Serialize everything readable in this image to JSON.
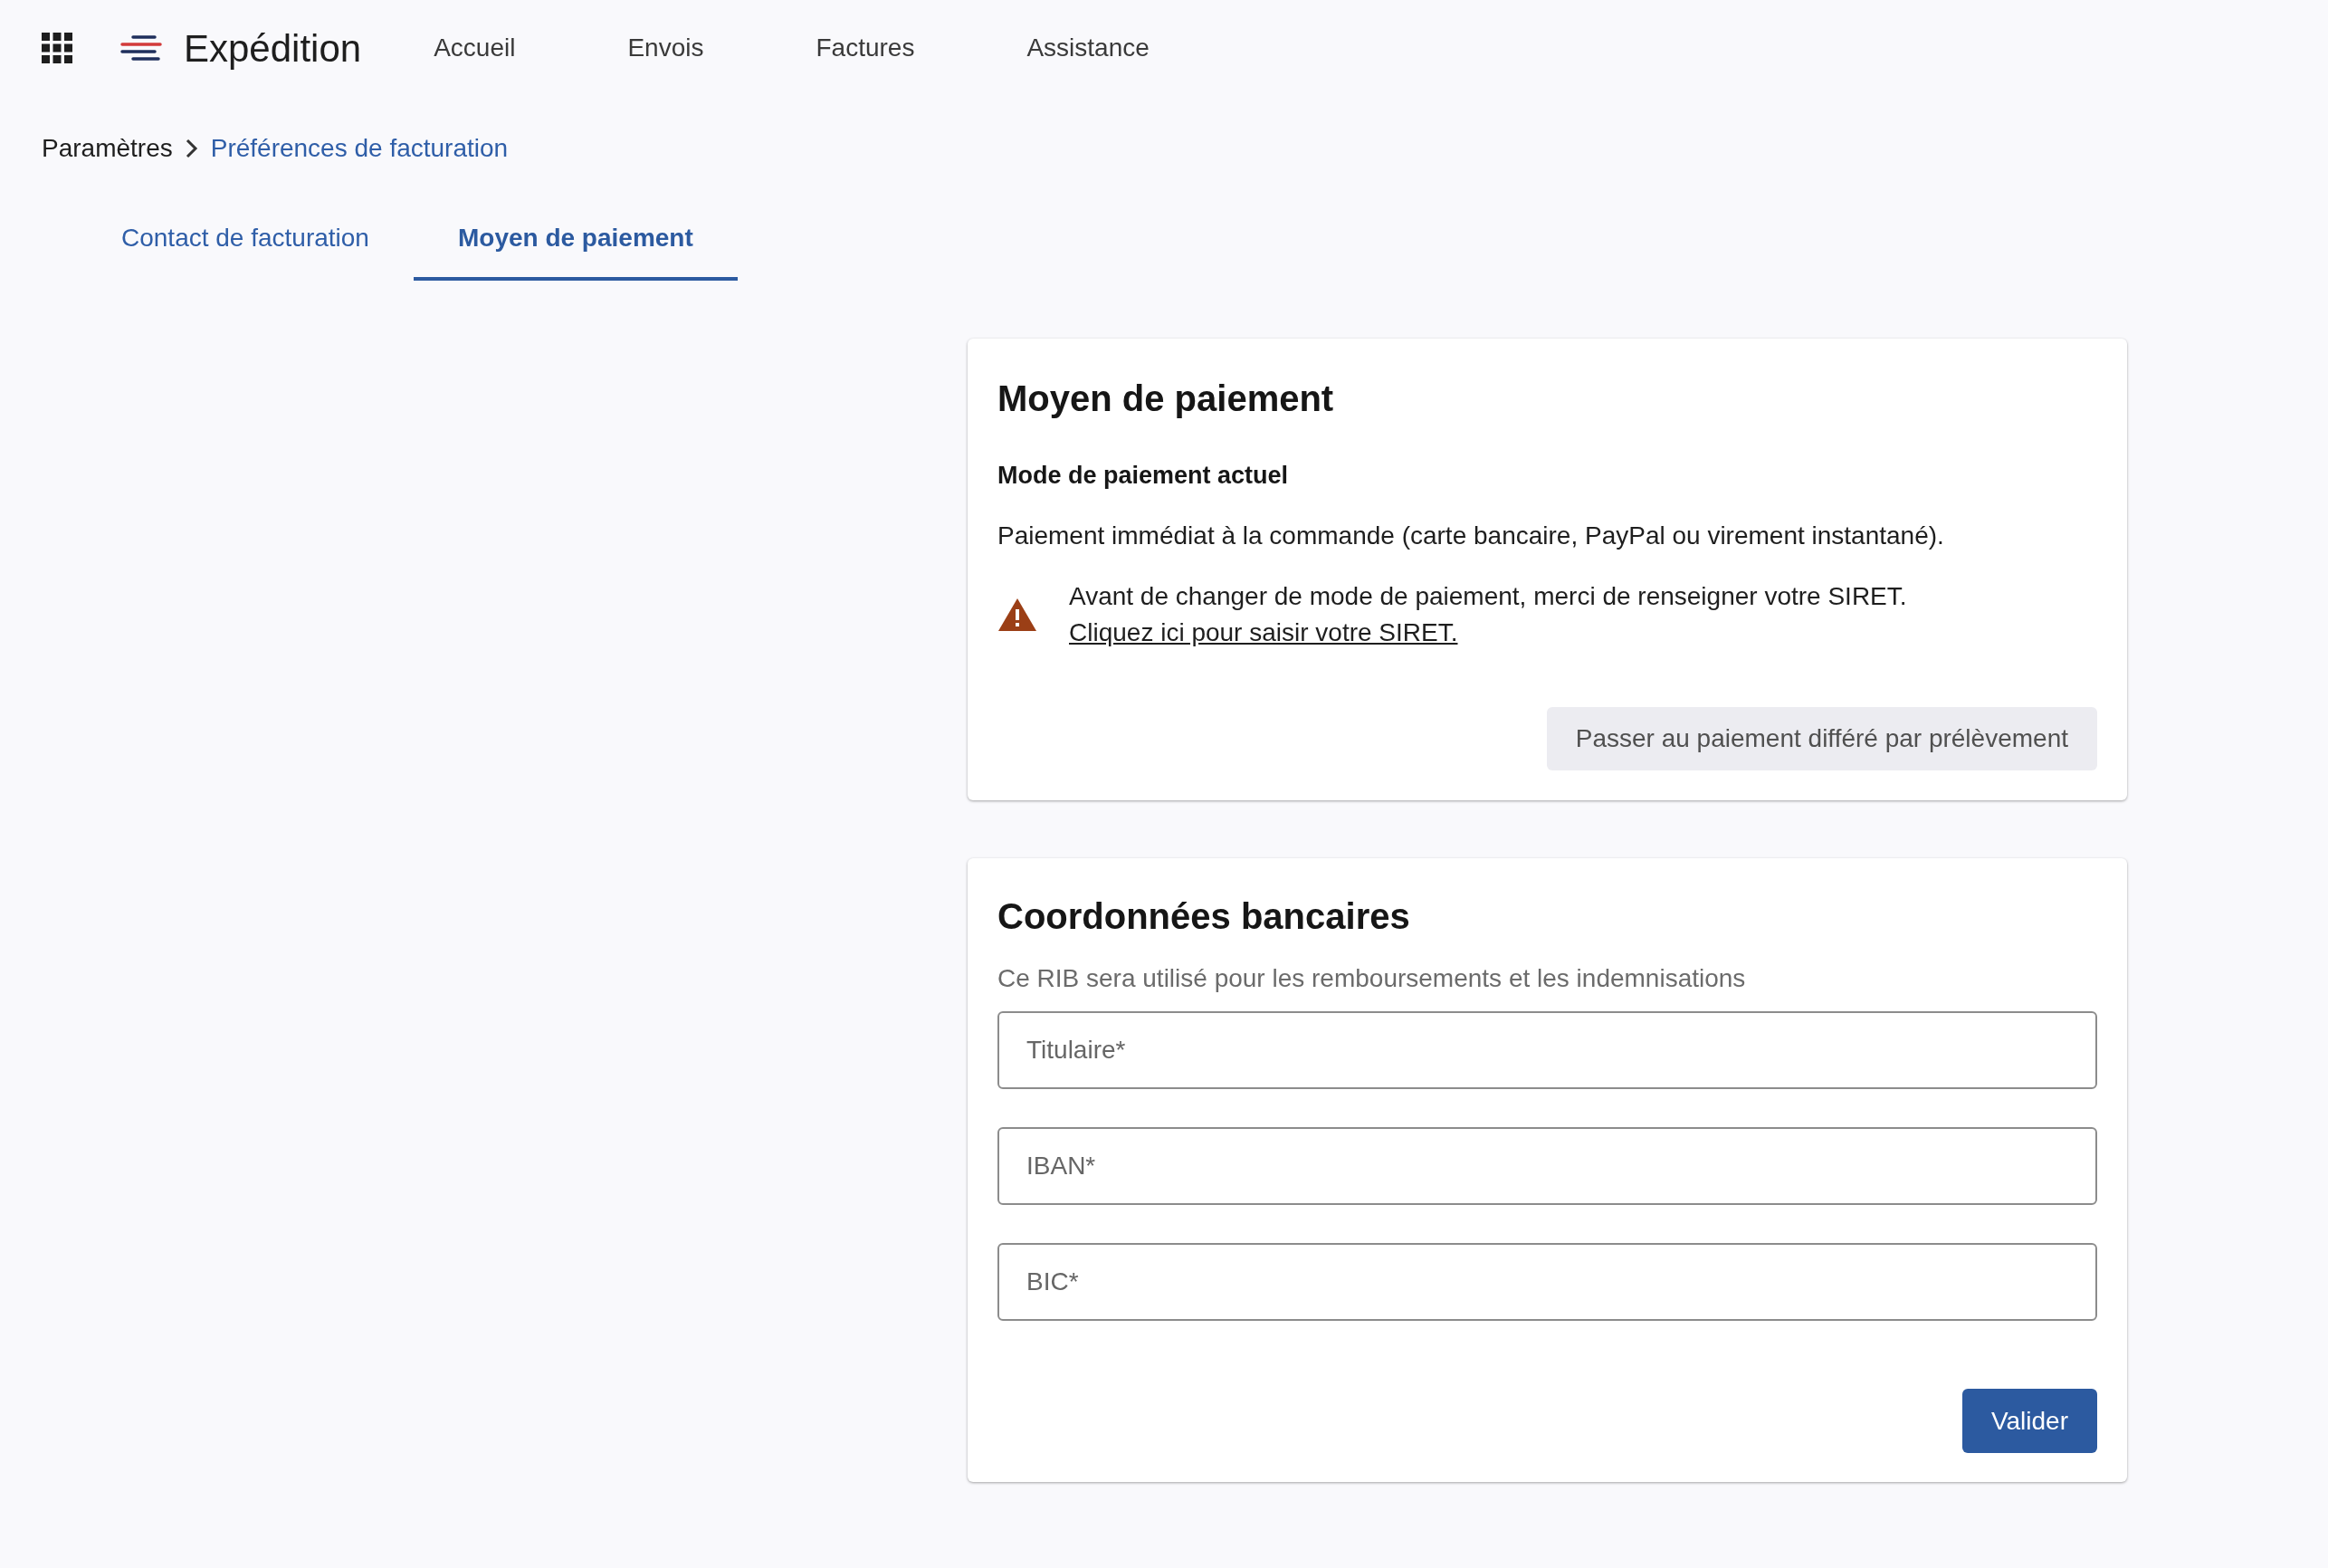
{
  "header": {
    "app_name": "Expédition",
    "nav": [
      {
        "label": "Accueil"
      },
      {
        "label": "Envois"
      },
      {
        "label": "Factures"
      },
      {
        "label": "Assistance"
      }
    ]
  },
  "breadcrumb": {
    "parent": "Paramètres",
    "current": "Préférences de facturation"
  },
  "tabs": [
    {
      "label": "Contact de facturation",
      "selected": false
    },
    {
      "label": "Moyen de paiement",
      "selected": true
    }
  ],
  "payment_card": {
    "title": "Moyen de paiement",
    "subtitle": "Mode de paiement actuel",
    "description": "Paiement immédiat à la commande (carte bancaire, PayPal ou virement instantané).",
    "warning": {
      "text": "Avant de changer de mode de paiement, merci de renseigner votre SIRET.",
      "link": "Cliquez ici pour saisir votre SIRET."
    },
    "button": "Passer au paiement différé par prélèvement"
  },
  "bank_card": {
    "title": "Coordonnées bancaires",
    "hint": "Ce RIB sera utilisé pour les remboursements et les indemnisations",
    "fields": [
      {
        "placeholder": "Titulaire*"
      },
      {
        "placeholder": "IBAN*"
      },
      {
        "placeholder": "BIC*"
      }
    ],
    "submit": "Valider"
  }
}
